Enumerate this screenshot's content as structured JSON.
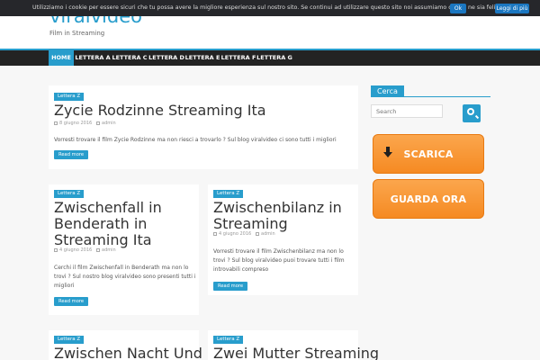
{
  "cookie": {
    "text": "Utilizziamo i cookie per essere sicuri che tu possa avere la migliore esperienza sul nostro sito. Se continui ad utilizzare questo sito noi assumiamo che tu ne sia felice.",
    "ok": "Ok",
    "more": "Leggi di più"
  },
  "site": {
    "title": "viralvideo",
    "tagline": "Film in Streaming"
  },
  "nav": {
    "items": [
      {
        "label": "HOME"
      },
      {
        "label": "LETTERA A"
      },
      {
        "label": "LETTERA C"
      },
      {
        "label": "LETTERA D"
      },
      {
        "label": "LETTERA E"
      },
      {
        "label": "LETTERA F"
      },
      {
        "label": "LETTERA G"
      }
    ]
  },
  "posts": [
    {
      "category": "Lettera Z",
      "title": "Zycie Rodzinne Streaming Ita",
      "date": "8 giugno 2016",
      "author": "admin",
      "excerpt": "Vorresti trovare il film Zycie Rodzinne ma non riesci a trovarlo ? Sul blog viralvideo ci sono tutti i migliori",
      "more": "Read more"
    },
    {
      "category": "Lettera Z",
      "title": "Zwischenfall in Benderath in Streaming Ita",
      "date": "4 giugno 2016",
      "author": "admin",
      "excerpt": "Cerchi il film Zwischenfall in Benderath ma non lo trovi ? Sul nostro blog viralvideo sono presenti tutti i migliori",
      "more": "Read more"
    },
    {
      "category": "Lettera Z",
      "title": "Zwischenbilanz in Streaming",
      "date": "4 giugno 2016",
      "author": "admin",
      "excerpt": "Vorresti trovare il film Zwischenbilanz ma non lo trovi ? Sul blog viralvideo puoi trovare tutti i film introvabili compreso",
      "more": "Read more"
    },
    {
      "category": "Lettera Z",
      "title": "Zwischen Nacht Und"
    },
    {
      "category": "Lettera Z",
      "title": "Zwei Mutter Streaming"
    }
  ],
  "sidebar": {
    "widget_title": "Cerca",
    "search_placeholder": "Search",
    "scarica": "SCARICA",
    "guarda": "GUARDA ORA"
  },
  "colors": {
    "accent": "#289dcc",
    "orange": "#f7931e",
    "nav_bg": "#232323"
  }
}
